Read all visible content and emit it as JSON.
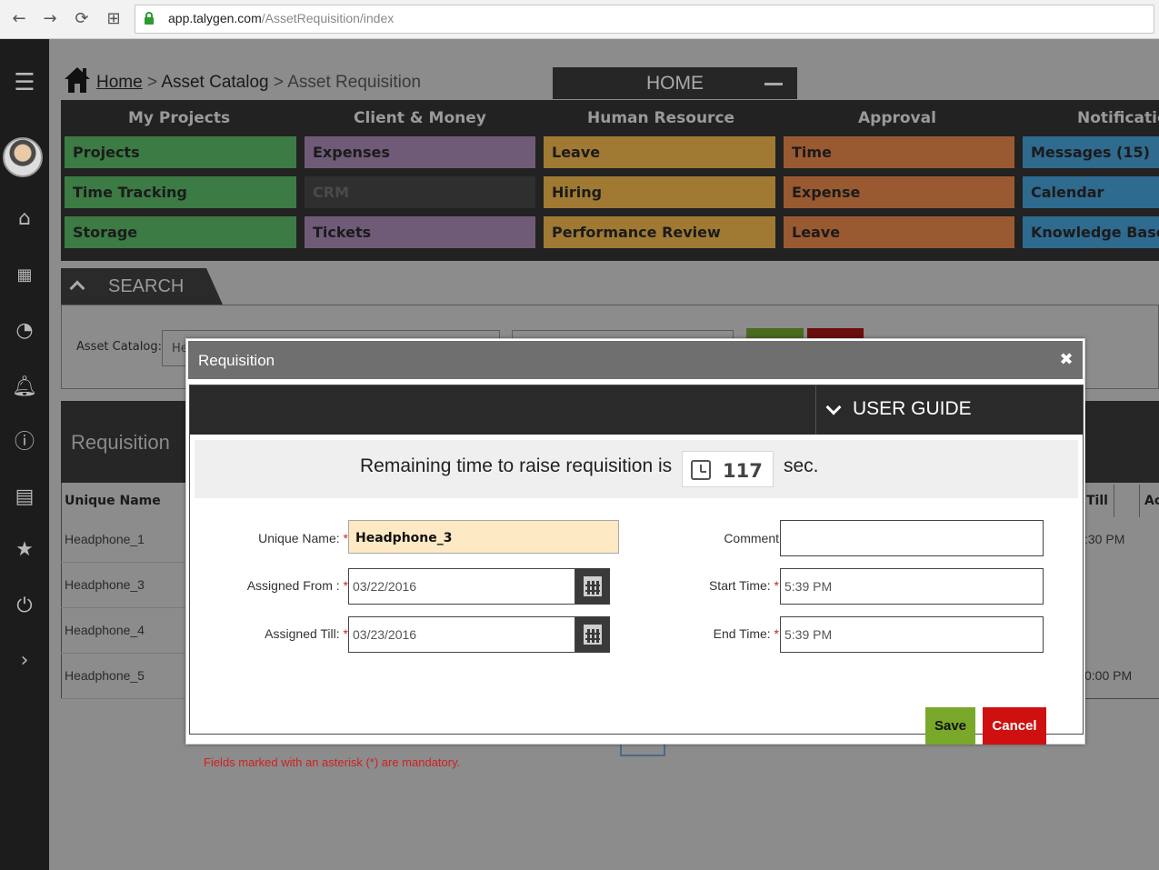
{
  "browser": {
    "url_domain": "app.talygen.com",
    "url_path": "/AssetRequisition/index"
  },
  "breadcrumb": {
    "home": "Home",
    "sep": ">",
    "catalog": "Asset Catalog",
    "current": "Asset Requisition"
  },
  "home_tab": {
    "label": "HOME"
  },
  "menu": {
    "columns": [
      {
        "heading": "My Projects",
        "items": [
          "Projects",
          "Time Tracking",
          "Storage"
        ]
      },
      {
        "heading": "Client & Money",
        "items": [
          "Expenses",
          "CRM",
          "Tickets"
        ]
      },
      {
        "heading": "Human Resource",
        "items": [
          "Leave",
          "Hiring",
          "Performance Review"
        ]
      },
      {
        "heading": "Approval",
        "items": [
          "Time",
          "Expense",
          "Leave"
        ]
      },
      {
        "heading": "Notifications",
        "items": [
          "Messages (15)",
          "Calendar",
          "Knowledge Base"
        ]
      }
    ]
  },
  "search": {
    "title": "SEARCH",
    "catalog_label": "Asset Catalog:",
    "catalog_value": "He"
  },
  "grid": {
    "title": "Requisition",
    "col_name": "Unique Name",
    "col_till": "Till",
    "col_action": "Ac",
    "rows": [
      {
        "name": "Headphone_1",
        "till": ":30 PM"
      },
      {
        "name": "Headphone_3",
        "till": ""
      },
      {
        "name": "Headphone_4",
        "till": ""
      },
      {
        "name": "Headphone_5",
        "till": "0:00 PM"
      }
    ]
  },
  "modal": {
    "title": "Requisition",
    "user_guide": "USER GUIDE",
    "timer_text": "Remaining time to raise requisition is",
    "timer_value": "117",
    "timer_unit": "sec.",
    "fields": {
      "unique_name_label": "Unique Name:",
      "unique_name_value": "Headphone_3",
      "assigned_from_label": "Assigned From :",
      "assigned_from_value": "03/22/2016",
      "assigned_till_label": "Assigned Till:",
      "assigned_till_value": "03/23/2016",
      "comment_label": "Comment",
      "comment_value": "",
      "start_time_label": "Start Time:",
      "start_time_value": "5:39 PM",
      "end_time_label": "End Time:",
      "end_time_value": "5:39 PM",
      "asterisk": "*"
    },
    "save": "Save",
    "cancel": "Cancel",
    "mandatory_note": "Fields marked with an asterisk (*) are mandatory.",
    "close_glyph": "✖"
  },
  "colors": {
    "save": "#7aa82a",
    "cancel": "#cf1010",
    "highlight_input": "#fde9c4"
  }
}
